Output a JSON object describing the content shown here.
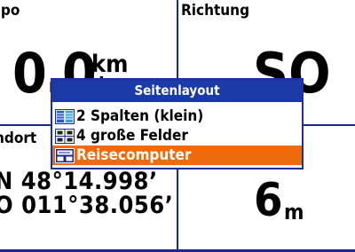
{
  "fields": {
    "top_left": {
      "label": "npo",
      "value": "0.0",
      "unit_top": "km",
      "unit_bottom": "h"
    },
    "top_right": {
      "label": "Richtung",
      "value": "SO"
    },
    "bottom_left": {
      "label": "ndort",
      "lat": "N  48°14.998’",
      "lon": "O 011°38.056’"
    },
    "bottom_right": {
      "value": "6",
      "unit": "m"
    }
  },
  "dialog": {
    "title": "Seitenlayout",
    "items": [
      {
        "label": "2 Spalten (klein)",
        "icon": "two-columns-icon",
        "selected": false
      },
      {
        "label": "4 große Felder",
        "icon": "four-fields-icon",
        "selected": false
      },
      {
        "label": "Reisecomputer",
        "icon": "trip-computer-icon",
        "selected": true
      }
    ]
  },
  "colors": {
    "divider": "#1a2a8a",
    "title_bar": "#1a3aa8",
    "selection": "#ee6a0a"
  }
}
